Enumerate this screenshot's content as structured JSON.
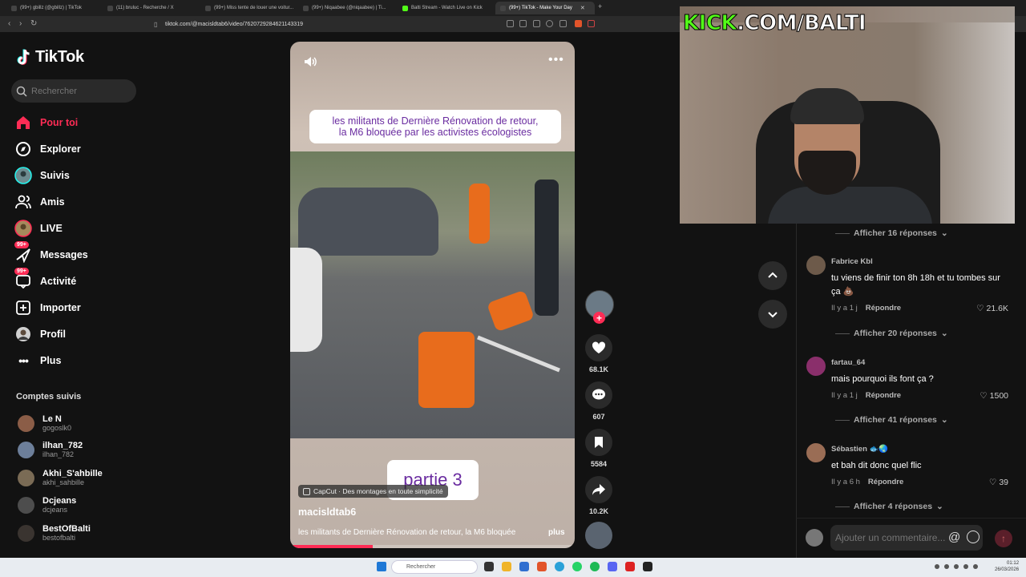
{
  "browser": {
    "tabs": [
      {
        "label": "(99+) gbillz (@gbillz) | TikTok",
        "active": false
      },
      {
        "label": "(11) bruluc - Recherche / X",
        "active": false
      },
      {
        "label": "(99+) Miss tente de louer une voitur...",
        "active": false
      },
      {
        "label": "(99+) Niqaabee (@niqaabee) | Ti...",
        "active": false
      },
      {
        "label": "Balti Stream - Watch Live on Kick",
        "active": false
      },
      {
        "label": "(99+) TikTok - Make Your Day",
        "active": true
      }
    ],
    "url": "tiktok.com/@macisldtab6/video/7620729284621143319"
  },
  "sidebar": {
    "brand": "TikTok",
    "search_placeholder": "Rechercher",
    "nav": [
      {
        "label": "Pour toi",
        "icon": "home-icon",
        "active": true,
        "badge": ""
      },
      {
        "label": "Explorer",
        "icon": "compass-icon",
        "active": false,
        "badge": ""
      },
      {
        "label": "Suivis",
        "icon": "following-avatar-icon",
        "active": false,
        "badge": ""
      },
      {
        "label": "Amis",
        "icon": "friends-icon",
        "active": false,
        "badge": ""
      },
      {
        "label": "LIVE",
        "icon": "live-avatar-icon",
        "active": false,
        "badge": ""
      },
      {
        "label": "Messages",
        "icon": "messages-icon",
        "active": false,
        "badge": "99+"
      },
      {
        "label": "Activité",
        "icon": "activity-icon",
        "active": false,
        "badge": "99+"
      },
      {
        "label": "Importer",
        "icon": "upload-icon",
        "active": false,
        "badge": ""
      },
      {
        "label": "Profil",
        "icon": "profile-avatar-icon",
        "active": false,
        "badge": ""
      },
      {
        "label": "Plus",
        "icon": "more-dots-icon",
        "active": false,
        "badge": ""
      }
    ],
    "following_title": "Comptes suivis",
    "following": [
      {
        "name": "Le N",
        "handle": "gogoslk0"
      },
      {
        "name": "ilhan_782",
        "handle": "ilhan_782"
      },
      {
        "name": "Akhi_S'ahbille",
        "handle": "akhi_sahbille"
      },
      {
        "name": "Dcjeans",
        "handle": "dcjeans"
      },
      {
        "name": "BestOfBalti",
        "handle": "bestofbalti"
      }
    ]
  },
  "video": {
    "overlay_title_line1": "les militants de Dernière Rénovation de retour,",
    "overlay_title_line2": "la M6 bloquée par les activistes écologistes",
    "part_label": "partie 3",
    "capcut_label": "CapCut · Des montages en toute simplicité",
    "author": "macisldtab6",
    "description": "les militants de Dernière Rénovation de retour, la M6 bloquée",
    "more_label": "plus",
    "progress": 0.29
  },
  "actions": {
    "likes": "68.1K",
    "comments": "607",
    "saves": "5584",
    "shares": "10.2K"
  },
  "comments": [
    {
      "replies_label": "Afficher 16 réponses"
    },
    {
      "user": "Fabrice Kbl",
      "text": "tu viens de finir ton 8h 18h et tu tombes sur ça 💩",
      "time": "Il y a 1 j",
      "reply": "Répondre",
      "likes": "21.6K",
      "replies_label": "Afficher 20 réponses"
    },
    {
      "user": "fartau_64",
      "text": "mais pourquoi ils font ça ?",
      "time": "Il y a 1 j",
      "reply": "Répondre",
      "likes": "1500",
      "replies_label": "Afficher 41 réponses"
    },
    {
      "user": "Sébastien 🐟🌏",
      "text": "et bah dit donc quel flic",
      "time": "Il y a 6 h",
      "reply": "Répondre",
      "likes": "39",
      "replies_label": "Afficher 4 réponses"
    }
  ],
  "comment_input": {
    "placeholder": "Ajouter un commentaire..."
  },
  "overlay": {
    "kick_a": "KICK",
    "kick_b": ".COM/BALTI"
  },
  "taskbar": {
    "search_placeholder": "Rechercher",
    "time": "01:12",
    "date": "26/03/2026"
  }
}
